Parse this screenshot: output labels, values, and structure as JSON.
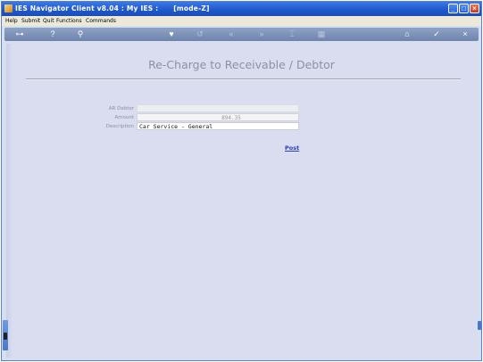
{
  "window": {
    "title": "IES Navigator Client v8.04 : My IES :      [mode-Z]",
    "buttons": {
      "minimize": "_",
      "maximize": "□",
      "close": "×"
    }
  },
  "menu": [
    "Help",
    "Submit",
    "Quit",
    "Functions",
    "Commands"
  ],
  "toolbar": {
    "icons": [
      "key-icon",
      "help-icon",
      "search-icon",
      "heart-icon",
      "refresh-icon",
      "back-icon",
      "forward-icon",
      "tag-icon",
      "grid-icon",
      "home-icon",
      "check-icon",
      "close-icon"
    ],
    "glyphs": {
      "key": "⊶",
      "help": "?",
      "search": "⚲",
      "heart": "♥",
      "refresh": "↺",
      "back": "«",
      "forward": "»",
      "tag": "⌶",
      "grid": "▦",
      "home": "⌂",
      "check": "✓",
      "close": "×"
    }
  },
  "form": {
    "heading": "Re-Charge to Receivable / Debtor",
    "fields": [
      {
        "label": "AR Debtor",
        "value": ""
      },
      {
        "label": "Amount",
        "value": "894.35"
      },
      {
        "label": "Description",
        "value": "Car Service - General"
      }
    ],
    "post_label": "Post"
  },
  "colors": {
    "titlebar": "#1f57c8",
    "content_bg": "#d9ddef",
    "heading": "#8b91a3",
    "link": "#2b3fb8"
  }
}
